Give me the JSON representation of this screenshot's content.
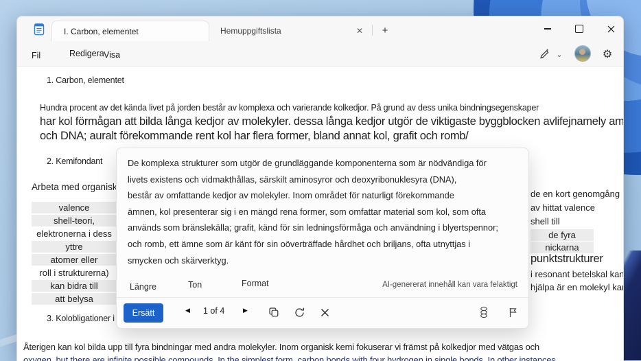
{
  "window": {
    "tabs": [
      {
        "label": "I. Carbon, elementet"
      },
      {
        "label": "Hemuppgiftslista"
      }
    ],
    "menu": {
      "file": "Fil",
      "edit": "Redigera",
      "view": "Visa"
    },
    "icons": {
      "tab_close": "✕",
      "new_tab": "+",
      "chevron_down": "⌄",
      "gear": "⚙",
      "prev": "◀",
      "next": "▶"
    }
  },
  "document": {
    "heading1": "1. Carbon, elementet",
    "para1": "Hundra procent av det kända livet på jorden består av komplexa och varierande kolkedjor. På grund av dess unika bindningsegenskaper",
    "para2_large": "har kol förmågan att bilda långa kedjor av molekyler. dessa långa kedjor utgör de viktigaste byggblocken avlifejnamely aminosyror",
    "para3_large": "och DNA; auralt förekommande rent kol har flera former, bland annat kol, grafit och romb/",
    "heading2": "2. Kemifondant",
    "left_intro": "Arbeta med organisk",
    "left_fragments": [
      {
        "text": "valence",
        "selected": true
      },
      {
        "text": "shell-teori,",
        "selected": true
      },
      {
        "text": "elektronerna i dess",
        "selected": false
      },
      {
        "text": "yttre",
        "selected": true
      },
      {
        "text": "atomer eller",
        "selected": true
      },
      {
        "text": "roll i strukturerna)",
        "selected": false
      },
      {
        "text": "kan bidra till",
        "selected": true
      },
      {
        "text": "att belysa",
        "selected": true
      }
    ],
    "right_fragments": [
      {
        "text": "de en kort genomgång",
        "selected": false
      },
      {
        "text": "av hittat valence",
        "selected": false
      },
      {
        "text": "shell till",
        "selected": false
      },
      {
        "text": "de fyra",
        "selected": true
      },
      {
        "text": "nickarna",
        "selected": true
      },
      {
        "text": "punktstrukturer",
        "selected": false
      },
      {
        "text": "i resonant betelskal kan",
        "selected": false
      },
      {
        "text": "hjälpa är en molekyl kan",
        "selected": false
      }
    ],
    "heading3": "3. Kolobligationer i (",
    "para4": "Återigen kan kol bilda upp till fyra bindningar med andra molekyler. Inom organisk kemi fokuserar vi främst på kolkedjor med vätgas och",
    "para5": "oxygen, but there are infinite possible compounds. In the simplest form, carbon bonds with four hydrogen in single bonds. In other instances,"
  },
  "popup": {
    "lines": [
      "De komplexa strukturer som utgör de grundläggande komponenterna som är nödvändiga för",
      "livets existens och vidmakthållas, särskilt aminosyror och deoxyribonuklesyra (DNA),",
      "består av omfattande kedjor av molekyler. Inom området för naturligt förekommande",
      "ämnen, kol presenterar sig i en mängd rena former, som omfattar material som kol, som ofta",
      "används som bränslekälla; grafit, känd för sin ledningsförmåga och användning i blyertspennor;",
      "och romb, ett ämne som är känt för sin oöverträffade hårdhet och briljans, ofta utnyttjas i",
      "smycken och skärverktyg."
    ],
    "options": {
      "longer": "Längre",
      "tone": "Ton",
      "format": "Format"
    },
    "disclaimer": "AI-genererat innehåll kan vara felaktigt",
    "replace_label": "Ersätt",
    "pager": "1 of 4"
  },
  "colors": {
    "accent_blue": "#1d62c8",
    "selection_gray": "#ececec",
    "navy_text": "#25356e"
  }
}
